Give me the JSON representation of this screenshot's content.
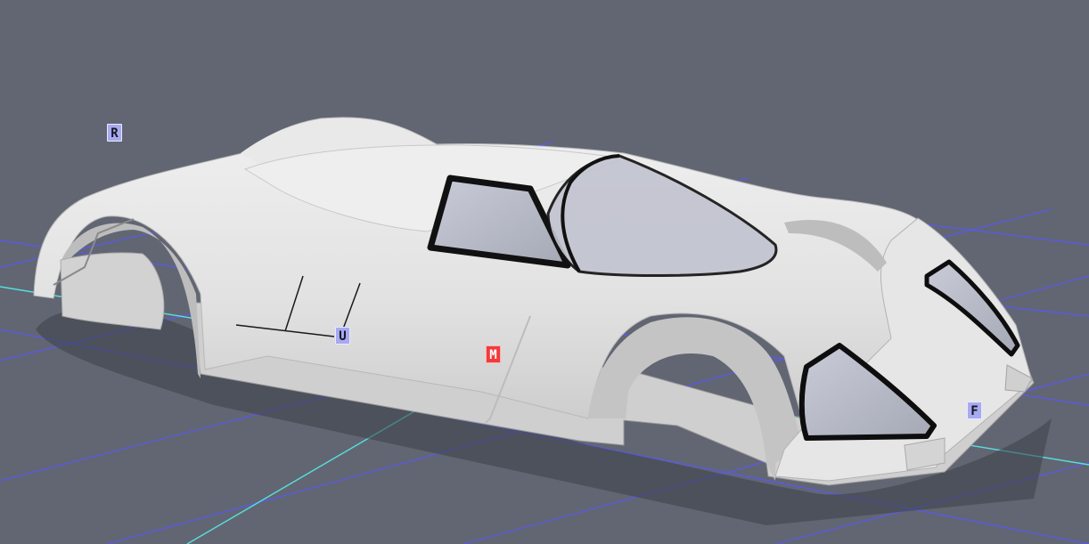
{
  "viewport": {
    "background_color": "#626672",
    "grid_color": "#5555e8",
    "axis_color": "#56e3e3",
    "body_color": "#d9d9d9"
  },
  "markers": [
    {
      "label": "R",
      "style": "blue"
    },
    {
      "label": "U",
      "style": "blue"
    },
    {
      "label": "M",
      "style": "red"
    },
    {
      "label": "F",
      "style": "blue"
    }
  ]
}
